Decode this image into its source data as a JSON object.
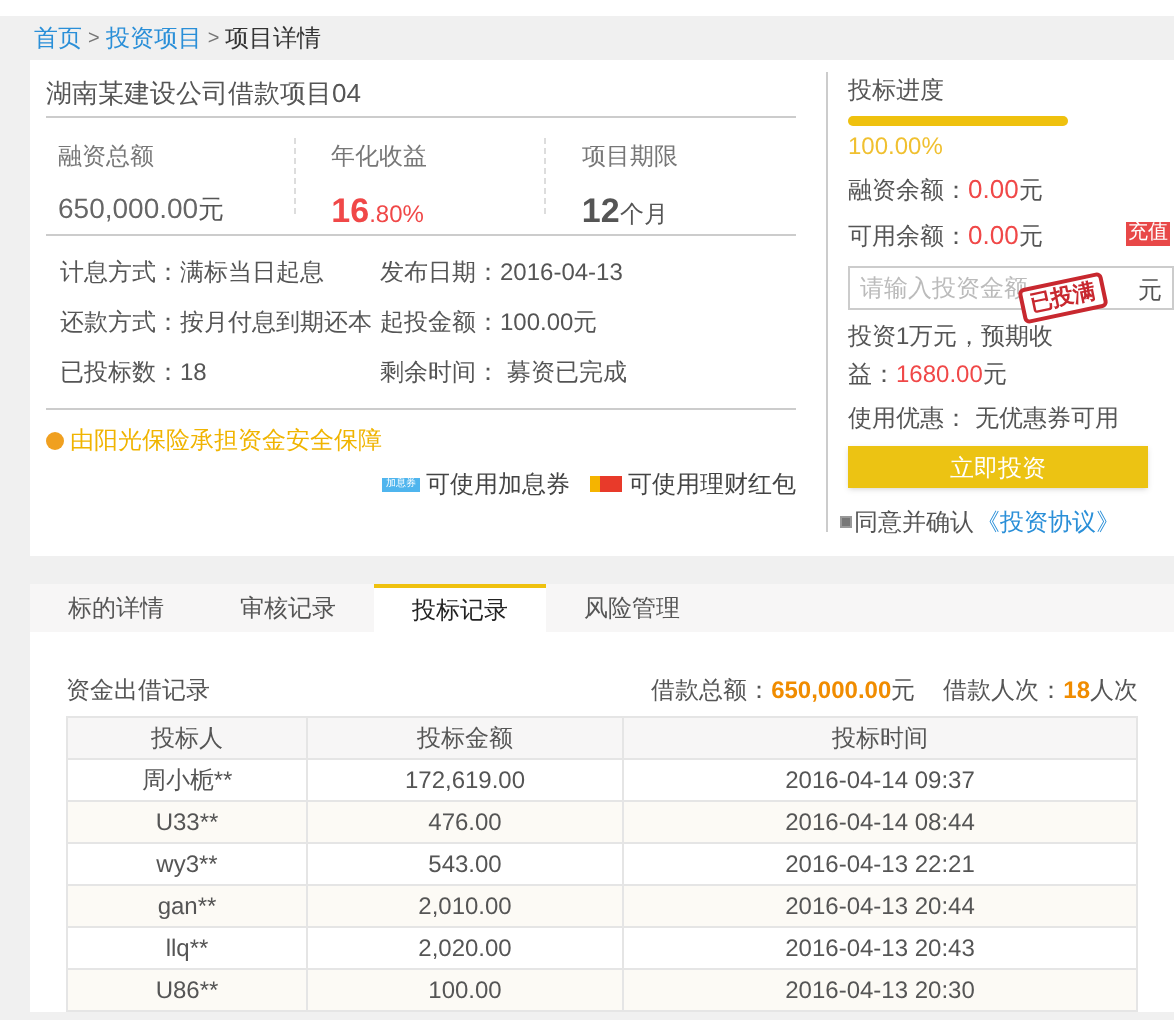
{
  "breadcrumb": [
    {
      "label": "首页",
      "kind": "link"
    },
    {
      "label": "投资项目",
      "kind": "link"
    },
    {
      "label": "项目详情",
      "kind": "current"
    }
  ],
  "breadcrumb_separator": ">",
  "project": {
    "title": "湖南某建设公司借款项目04",
    "stats": [
      {
        "label": "融资总额",
        "value": "650,000.00",
        "unit": "元",
        "kind": "plain"
      },
      {
        "label": "年化收益",
        "value": "16",
        "unit": ".80%",
        "kind": "rate"
      },
      {
        "label": "项目期限",
        "value": "12",
        "unit": "个月",
        "kind": "bold"
      }
    ],
    "details": [
      {
        "label": "计息方式：",
        "value": "满标当日起息"
      },
      {
        "label": "发布日期：",
        "value": "2016-04-13"
      },
      {
        "label": "还款方式：",
        "value": "按月付息到期还本"
      },
      {
        "label": "起投金额：",
        "value": "100.00元"
      },
      {
        "label": "已投标数：",
        "value": "18"
      },
      {
        "label": "剩余时间：",
        "value": " 募资已完成"
      }
    ],
    "guarantee": "由阳光保险承担资金安全保障",
    "perks": [
      {
        "label": "可使用加息券",
        "badge": "加息券",
        "kind": "coupon"
      },
      {
        "label": "可使用理财红包",
        "kind": "redpacket"
      }
    ]
  },
  "invest": {
    "progress_label": "投标进度",
    "level": 1.0,
    "percent": "100.00%",
    "balance": {
      "label": "融资余额：",
      "value": "0.00",
      "unit": "元"
    },
    "available": {
      "label": "可用余额：",
      "value": "0.00",
      "unit": "元"
    },
    "recharge": "充值",
    "amount_field": {
      "placeholder": "请输入投资金额",
      "unit": "元"
    },
    "stamp": "已投满",
    "expected": {
      "text": "投资1万元，预期收益：",
      "value": "1680.00",
      "unit": "元"
    },
    "discount": {
      "label": "使用优惠：",
      "value": "无优惠券可用"
    },
    "invest_button": "立即投资",
    "agree": {
      "checked": true,
      "text": "同意并确认",
      "link": "《投资协议》"
    }
  },
  "tabs": [
    {
      "label": "标的详情",
      "selected": false
    },
    {
      "label": "审核记录",
      "selected": false
    },
    {
      "label": "投标记录",
      "selected": true
    },
    {
      "label": "风险管理",
      "selected": false
    }
  ],
  "records": {
    "title": "资金出借记录",
    "total_label": "借款总额：",
    "total_value": "650,000.00",
    "total_unit": "元",
    "count_label": "借款人次：",
    "count_value": "18",
    "count_unit": "人次",
    "columns": [
      "投标人",
      "投标金额",
      "投标时间"
    ],
    "rows": [
      [
        "周小栀**",
        "172,619.00",
        "2016-04-14 09:37"
      ],
      [
        "U33**",
        "476.00",
        "2016-04-14 08:44"
      ],
      [
        "wy3**",
        "543.00",
        "2016-04-13 22:21"
      ],
      [
        "gan**",
        "2,010.00",
        "2016-04-13 20:44"
      ],
      [
        "llq**",
        "2,020.00",
        "2016-04-13 20:43"
      ],
      [
        "U86**",
        "100.00",
        "2016-04-13 20:30"
      ]
    ]
  }
}
